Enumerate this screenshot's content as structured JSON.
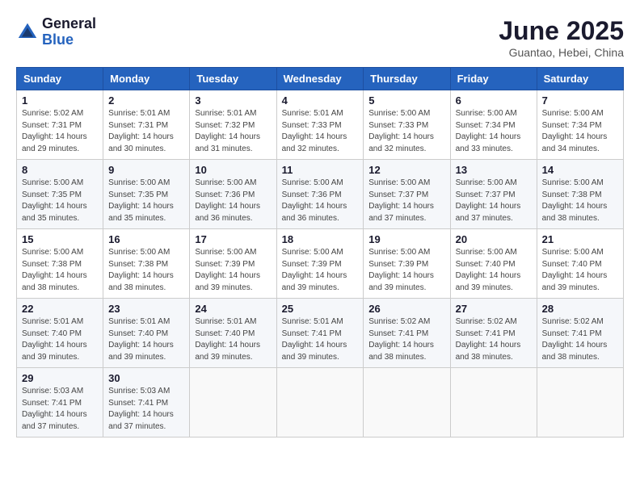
{
  "header": {
    "logo_general": "General",
    "logo_blue": "Blue",
    "title": "June 2025",
    "subtitle": "Guantao, Hebei, China"
  },
  "weekdays": [
    "Sunday",
    "Monday",
    "Tuesday",
    "Wednesday",
    "Thursday",
    "Friday",
    "Saturday"
  ],
  "weeks": [
    [
      {
        "day": "1",
        "sunrise": "Sunrise: 5:02 AM",
        "sunset": "Sunset: 7:31 PM",
        "daylight": "Daylight: 14 hours and 29 minutes."
      },
      {
        "day": "2",
        "sunrise": "Sunrise: 5:01 AM",
        "sunset": "Sunset: 7:31 PM",
        "daylight": "Daylight: 14 hours and 30 minutes."
      },
      {
        "day": "3",
        "sunrise": "Sunrise: 5:01 AM",
        "sunset": "Sunset: 7:32 PM",
        "daylight": "Daylight: 14 hours and 31 minutes."
      },
      {
        "day": "4",
        "sunrise": "Sunrise: 5:01 AM",
        "sunset": "Sunset: 7:33 PM",
        "daylight": "Daylight: 14 hours and 32 minutes."
      },
      {
        "day": "5",
        "sunrise": "Sunrise: 5:00 AM",
        "sunset": "Sunset: 7:33 PM",
        "daylight": "Daylight: 14 hours and 32 minutes."
      },
      {
        "day": "6",
        "sunrise": "Sunrise: 5:00 AM",
        "sunset": "Sunset: 7:34 PM",
        "daylight": "Daylight: 14 hours and 33 minutes."
      },
      {
        "day": "7",
        "sunrise": "Sunrise: 5:00 AM",
        "sunset": "Sunset: 7:34 PM",
        "daylight": "Daylight: 14 hours and 34 minutes."
      }
    ],
    [
      {
        "day": "8",
        "sunrise": "Sunrise: 5:00 AM",
        "sunset": "Sunset: 7:35 PM",
        "daylight": "Daylight: 14 hours and 35 minutes."
      },
      {
        "day": "9",
        "sunrise": "Sunrise: 5:00 AM",
        "sunset": "Sunset: 7:35 PM",
        "daylight": "Daylight: 14 hours and 35 minutes."
      },
      {
        "day": "10",
        "sunrise": "Sunrise: 5:00 AM",
        "sunset": "Sunset: 7:36 PM",
        "daylight": "Daylight: 14 hours and 36 minutes."
      },
      {
        "day": "11",
        "sunrise": "Sunrise: 5:00 AM",
        "sunset": "Sunset: 7:36 PM",
        "daylight": "Daylight: 14 hours and 36 minutes."
      },
      {
        "day": "12",
        "sunrise": "Sunrise: 5:00 AM",
        "sunset": "Sunset: 7:37 PM",
        "daylight": "Daylight: 14 hours and 37 minutes."
      },
      {
        "day": "13",
        "sunrise": "Sunrise: 5:00 AM",
        "sunset": "Sunset: 7:37 PM",
        "daylight": "Daylight: 14 hours and 37 minutes."
      },
      {
        "day": "14",
        "sunrise": "Sunrise: 5:00 AM",
        "sunset": "Sunset: 7:38 PM",
        "daylight": "Daylight: 14 hours and 38 minutes."
      }
    ],
    [
      {
        "day": "15",
        "sunrise": "Sunrise: 5:00 AM",
        "sunset": "Sunset: 7:38 PM",
        "daylight": "Daylight: 14 hours and 38 minutes."
      },
      {
        "day": "16",
        "sunrise": "Sunrise: 5:00 AM",
        "sunset": "Sunset: 7:38 PM",
        "daylight": "Daylight: 14 hours and 38 minutes."
      },
      {
        "day": "17",
        "sunrise": "Sunrise: 5:00 AM",
        "sunset": "Sunset: 7:39 PM",
        "daylight": "Daylight: 14 hours and 39 minutes."
      },
      {
        "day": "18",
        "sunrise": "Sunrise: 5:00 AM",
        "sunset": "Sunset: 7:39 PM",
        "daylight": "Daylight: 14 hours and 39 minutes."
      },
      {
        "day": "19",
        "sunrise": "Sunrise: 5:00 AM",
        "sunset": "Sunset: 7:39 PM",
        "daylight": "Daylight: 14 hours and 39 minutes."
      },
      {
        "day": "20",
        "sunrise": "Sunrise: 5:00 AM",
        "sunset": "Sunset: 7:40 PM",
        "daylight": "Daylight: 14 hours and 39 minutes."
      },
      {
        "day": "21",
        "sunrise": "Sunrise: 5:00 AM",
        "sunset": "Sunset: 7:40 PM",
        "daylight": "Daylight: 14 hours and 39 minutes."
      }
    ],
    [
      {
        "day": "22",
        "sunrise": "Sunrise: 5:01 AM",
        "sunset": "Sunset: 7:40 PM",
        "daylight": "Daylight: 14 hours and 39 minutes."
      },
      {
        "day": "23",
        "sunrise": "Sunrise: 5:01 AM",
        "sunset": "Sunset: 7:40 PM",
        "daylight": "Daylight: 14 hours and 39 minutes."
      },
      {
        "day": "24",
        "sunrise": "Sunrise: 5:01 AM",
        "sunset": "Sunset: 7:40 PM",
        "daylight": "Daylight: 14 hours and 39 minutes."
      },
      {
        "day": "25",
        "sunrise": "Sunrise: 5:01 AM",
        "sunset": "Sunset: 7:41 PM",
        "daylight": "Daylight: 14 hours and 39 minutes."
      },
      {
        "day": "26",
        "sunrise": "Sunrise: 5:02 AM",
        "sunset": "Sunset: 7:41 PM",
        "daylight": "Daylight: 14 hours and 38 minutes."
      },
      {
        "day": "27",
        "sunrise": "Sunrise: 5:02 AM",
        "sunset": "Sunset: 7:41 PM",
        "daylight": "Daylight: 14 hours and 38 minutes."
      },
      {
        "day": "28",
        "sunrise": "Sunrise: 5:02 AM",
        "sunset": "Sunset: 7:41 PM",
        "daylight": "Daylight: 14 hours and 38 minutes."
      }
    ],
    [
      {
        "day": "29",
        "sunrise": "Sunrise: 5:03 AM",
        "sunset": "Sunset: 7:41 PM",
        "daylight": "Daylight: 14 hours and 37 minutes."
      },
      {
        "day": "30",
        "sunrise": "Sunrise: 5:03 AM",
        "sunset": "Sunset: 7:41 PM",
        "daylight": "Daylight: 14 hours and 37 minutes."
      },
      null,
      null,
      null,
      null,
      null
    ]
  ]
}
